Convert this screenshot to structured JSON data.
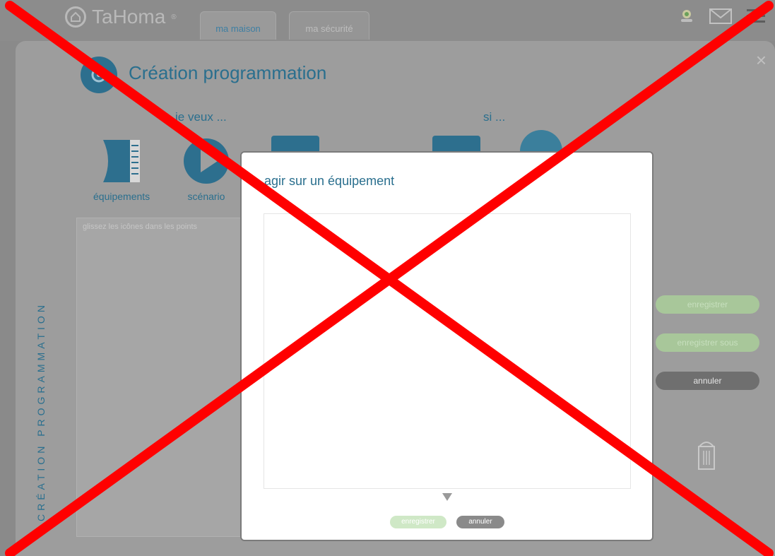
{
  "app": {
    "name": "TaHoma",
    "trademark": "®"
  },
  "tabs": [
    {
      "label": "ma maison",
      "active": true
    },
    {
      "label": "ma sécurité",
      "active": false
    }
  ],
  "top_icons": [
    "user-icon",
    "mail-icon",
    "menu-icon"
  ],
  "modal": {
    "title": "Création programmation",
    "close": "×",
    "left_heading": "je veux ...",
    "right_heading": "si ...",
    "tools": [
      {
        "label": "équipements",
        "icon": "equipment-icon"
      },
      {
        "label": "scénario",
        "icon": "play-icon"
      }
    ],
    "vertical_label": "CRÉATION PROGRAMMATION",
    "dropzone_hint": "glissez les icônes dans les points",
    "buttons": {
      "save": "enregistrer",
      "save_as": "enregistrer sous",
      "cancel": "annuler"
    }
  },
  "dialog": {
    "title": "agir sur un équipement",
    "save": "enregistrer",
    "cancel": "annuler"
  },
  "colors": {
    "accent": "#2a6f8e",
    "overlay_cross": "#ff0000",
    "save_button": "#cfe8c6",
    "cancel_button": "#8a8a8a"
  }
}
